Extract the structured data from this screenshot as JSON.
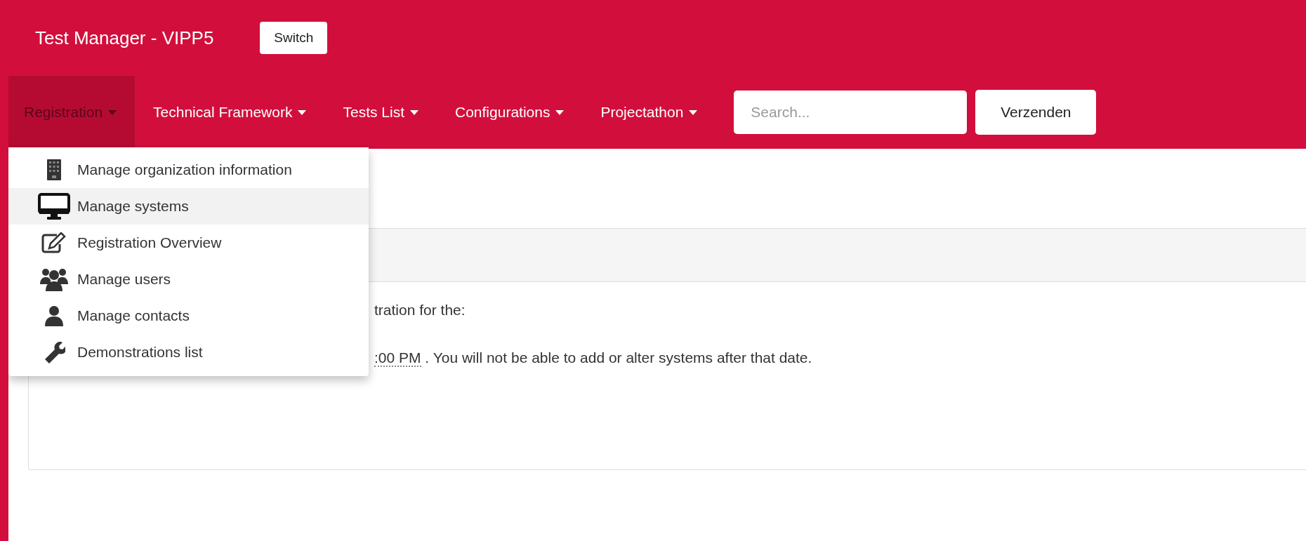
{
  "header": {
    "title": "Test Manager - VIPP5",
    "switch_button": "Switch"
  },
  "nav": {
    "items": [
      {
        "label": "Registration",
        "selected": true
      },
      {
        "label": "Technical Framework",
        "selected": false
      },
      {
        "label": "Tests List",
        "selected": false
      },
      {
        "label": "Configurations",
        "selected": false
      },
      {
        "label": "Projectathon",
        "selected": false
      }
    ],
    "search": {
      "placeholder": "Search..."
    },
    "submit_button": "Verzenden"
  },
  "dropdown": {
    "items": [
      {
        "kind": "building",
        "label": "Manage organization information",
        "selected": false
      },
      {
        "kind": "monitor",
        "label": "Manage systems",
        "selected": true
      },
      {
        "kind": "edit",
        "label": "Registration Overview",
        "selected": false
      },
      {
        "kind": "users",
        "label": "Manage users",
        "selected": false
      },
      {
        "kind": "user",
        "label": "Manage contacts",
        "selected": false
      },
      {
        "kind": "wrench",
        "label": "Demonstrations list",
        "selected": false
      }
    ]
  },
  "panel": {
    "lines": [
      {
        "text": "tration for the:"
      },
      {
        "date": ":00 PM",
        "text": " . You will not be able to add or alter systems after that date."
      }
    ]
  }
}
